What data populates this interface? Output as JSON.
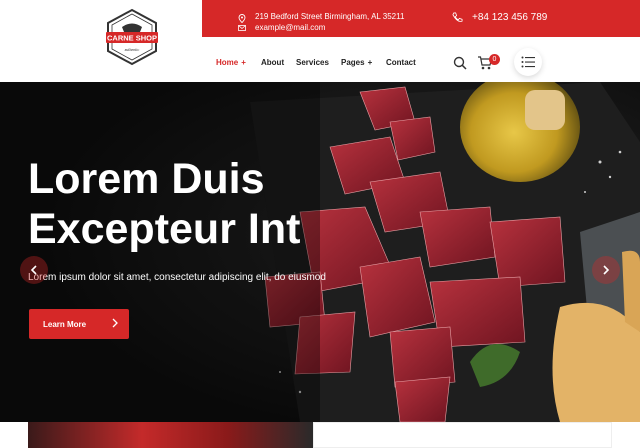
{
  "brand": {
    "name": "CARNE SHOP",
    "tagline": "authentic",
    "accent": "#d62828"
  },
  "topbar": {
    "address": "219 Bedford Street Birmingham, AL 35211",
    "email": "example@mail.com",
    "phone": "+84 123 456 789"
  },
  "nav": {
    "items": [
      {
        "label": "Home",
        "has_plus": true,
        "active": true
      },
      {
        "label": "About",
        "has_plus": false,
        "active": false
      },
      {
        "label": "Services",
        "has_plus": false,
        "active": false
      },
      {
        "label": "Pages",
        "has_plus": true,
        "active": false
      },
      {
        "label": "Contact",
        "has_plus": false,
        "active": false
      }
    ],
    "plus_glyph": "+",
    "cart_count": "0"
  },
  "hero": {
    "title_line1": "Lorem Duis",
    "title_line2": "Excepteur Int",
    "subtitle": "Lorem ipsum dolor sit amet, consectetur adipiscing elit, do eiusmod",
    "button_label": "Learn More"
  },
  "icons": [
    "location-icon",
    "mail-icon",
    "phone-icon",
    "search-icon",
    "cart-icon",
    "menu-list-icon",
    "chevron-left-icon",
    "chevron-right-icon",
    "arrow-right-icon"
  ]
}
